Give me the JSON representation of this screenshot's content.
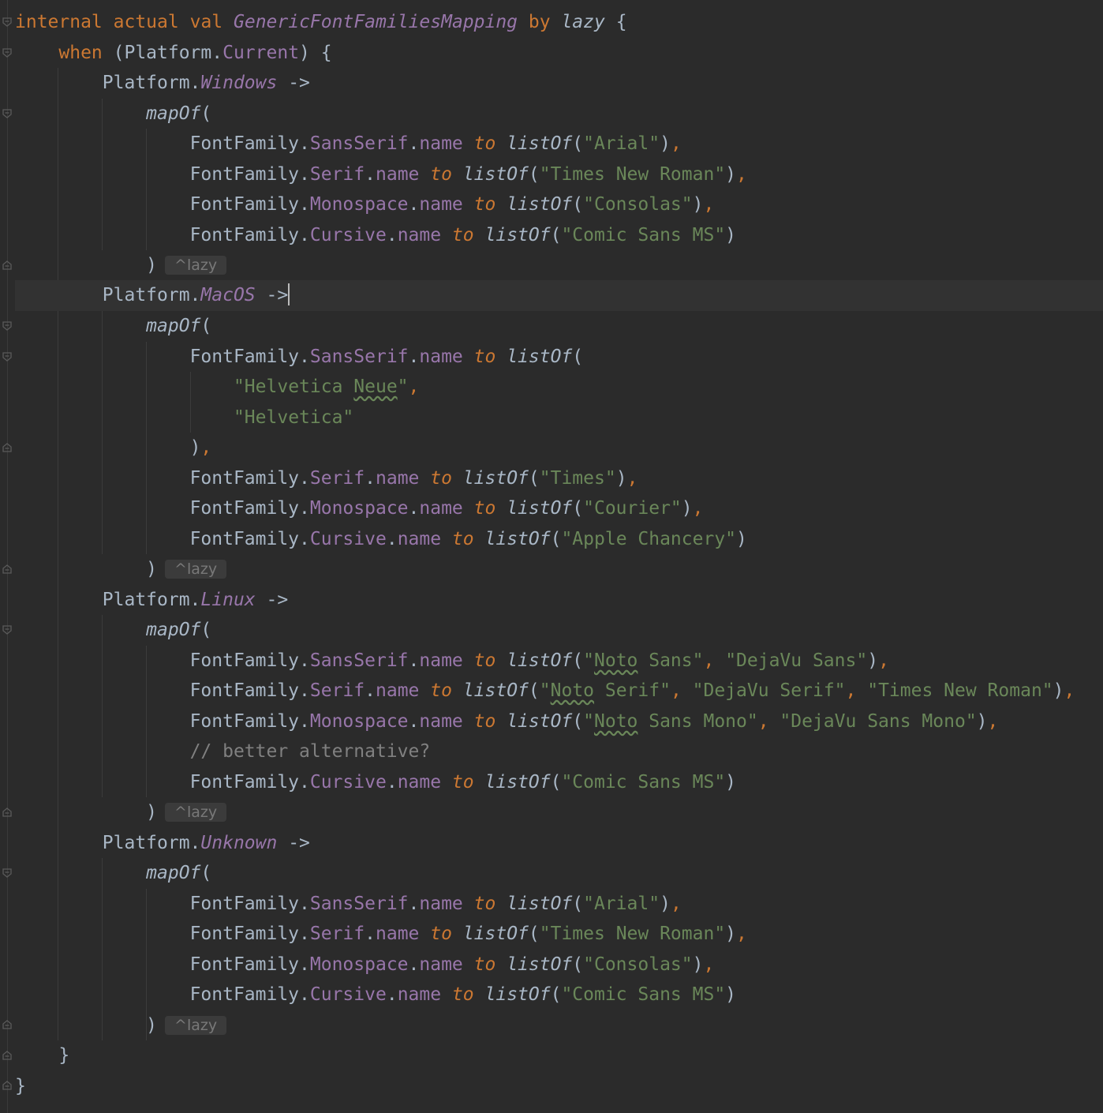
{
  "editor": {
    "language": "Kotlin",
    "theme_colors": {
      "background": "#2b2b2b",
      "current_line": "#323232",
      "keyword": "#cc7832",
      "property": "#9876aa",
      "string": "#6a8759",
      "comment": "#808080",
      "default": "#a9b7c6"
    },
    "icons": {
      "intention_bulb": "lightbulb-icon",
      "fold_marker": "fold-marker-icon"
    },
    "caret_after_line": 10
  },
  "code": {
    "l1": {
      "kw1": "internal",
      "kw2": "actual",
      "kw3": "val",
      "name": "GenericFontFamiliesMapping",
      "kw4": "by",
      "fn": "lazy",
      "open": " {"
    },
    "l2": {
      "kw": "when",
      "rest": " (Platform.",
      "prop": "Current",
      "end": ") {"
    },
    "l3": {
      "pre": "Platform.",
      "prop": "Windows",
      "arrow": " ->"
    },
    "l4": {
      "fn": "mapOf",
      "paren": "("
    },
    "l5": {
      "pre": "FontFamily.",
      "family": "SansSerif",
      "dot": ".",
      "name": "name",
      "to": "to",
      "fn": "listOf",
      "open": "(",
      "s1": "\"Arial\"",
      "close": ")",
      "comma": ","
    },
    "l6": {
      "pre": "FontFamily.",
      "family": "Serif",
      "dot": ".",
      "name": "name",
      "to": "to",
      "fn": "listOf",
      "open": "(",
      "s1": "\"Times New Roman\"",
      "close": ")",
      "comma": ","
    },
    "l7": {
      "pre": "FontFamily.",
      "family": "Monospace",
      "dot": ".",
      "name": "name",
      "to": "to",
      "fn": "listOf",
      "open": "(",
      "s1": "\"Consolas\"",
      "close": ")",
      "comma": ","
    },
    "l8": {
      "pre": "FontFamily.",
      "family": "Cursive",
      "dot": ".",
      "name": "name",
      "to": "to",
      "fn": "listOf",
      "open": "(",
      "s1": "\"Comic Sans MS\"",
      "close": ")"
    },
    "l9": {
      "paren": ")",
      "hint": "^lazy"
    },
    "l10": {
      "pre": "Platform.",
      "prop": "MacOS",
      "arrow": " ->"
    },
    "l11": {
      "fn": "mapOf",
      "paren": "("
    },
    "l12": {
      "pre": "FontFamily.",
      "family": "SansSerif",
      "dot": ".",
      "name": "name",
      "to": "to",
      "fn": "listOf",
      "open": "("
    },
    "l13": {
      "q1": "\"Helvetica ",
      "typo": "Neue",
      "q2": "\"",
      "comma": ","
    },
    "l14": {
      "s1": "\"Helvetica\""
    },
    "l15": {
      "close": ")",
      "comma": ","
    },
    "l16": {
      "pre": "FontFamily.",
      "family": "Serif",
      "dot": ".",
      "name": "name",
      "to": "to",
      "fn": "listOf",
      "open": "(",
      "s1": "\"Times\"",
      "close": ")",
      "comma": ","
    },
    "l17": {
      "pre": "FontFamily.",
      "family": "Monospace",
      "dot": ".",
      "name": "name",
      "to": "to",
      "fn": "listOf",
      "open": "(",
      "s1": "\"Courier\"",
      "close": ")",
      "comma": ","
    },
    "l18": {
      "pre": "FontFamily.",
      "family": "Cursive",
      "dot": ".",
      "name": "name",
      "to": "to",
      "fn": "listOf",
      "open": "(",
      "s1": "\"Apple Chancery\"",
      "close": ")"
    },
    "l19": {
      "paren": ")",
      "hint": "^lazy"
    },
    "l20": {
      "pre": "Platform.",
      "prop": "Linux",
      "arrow": " ->"
    },
    "l21": {
      "fn": "mapOf",
      "paren": "("
    },
    "l22": {
      "pre": "FontFamily.",
      "family": "SansSerif",
      "dot": ".",
      "name": "name",
      "to": "to",
      "fn": "listOf",
      "open": "(",
      "q": "\"",
      "typo": "Noto",
      "s1rest": " Sans\"",
      "sep": ", ",
      "s2": "\"DejaVu Sans\"",
      "close": ")",
      "comma": ","
    },
    "l23": {
      "pre": "FontFamily.",
      "family": "Serif",
      "dot": ".",
      "name": "name",
      "to": "to",
      "fn": "listOf",
      "open": "(",
      "q": "\"",
      "typo": "Noto",
      "s1rest": " Serif\"",
      "sep": ", ",
      "s2": "\"DejaVu Serif\"",
      "sep2": ", ",
      "s3": "\"Times New Roman\"",
      "close": ")",
      "comma": ","
    },
    "l24": {
      "pre": "FontFamily.",
      "family": "Monospace",
      "dot": ".",
      "name": "name",
      "to": "to",
      "fn": "listOf",
      "open": "(",
      "q": "\"",
      "typo": "Noto",
      "s1rest": " Sans Mono\"",
      "sep": ", ",
      "s2": "\"DejaVu Sans Mono\"",
      "close": ")",
      "comma": ","
    },
    "l25": {
      "comment": "// better alternative?"
    },
    "l26": {
      "pre": "FontFamily.",
      "family": "Cursive",
      "dot": ".",
      "name": "name",
      "to": "to",
      "fn": "listOf",
      "open": "(",
      "s1": "\"Comic Sans MS\"",
      "close": ")"
    },
    "l27": {
      "paren": ")",
      "hint": "^lazy"
    },
    "l28": {
      "pre": "Platform.",
      "prop": "Unknown",
      "arrow": " ->"
    },
    "l29": {
      "fn": "mapOf",
      "paren": "("
    },
    "l30": {
      "pre": "FontFamily.",
      "family": "SansSerif",
      "dot": ".",
      "name": "name",
      "to": "to",
      "fn": "listOf",
      "open": "(",
      "s1": "\"Arial\"",
      "close": ")",
      "comma": ","
    },
    "l31": {
      "pre": "FontFamily.",
      "family": "Serif",
      "dot": ".",
      "name": "name",
      "to": "to",
      "fn": "listOf",
      "open": "(",
      "s1": "\"Times New Roman\"",
      "close": ")",
      "comma": ","
    },
    "l32": {
      "pre": "FontFamily.",
      "family": "Monospace",
      "dot": ".",
      "name": "name",
      "to": "to",
      "fn": "listOf",
      "open": "(",
      "s1": "\"Consolas\"",
      "close": ")",
      "comma": ","
    },
    "l33": {
      "pre": "FontFamily.",
      "family": "Cursive",
      "dot": ".",
      "name": "name",
      "to": "to",
      "fn": "listOf",
      "open": "(",
      "s1": "\"Comic Sans MS\"",
      "close": ")"
    },
    "l34": {
      "paren": ")",
      "hint": "^lazy"
    },
    "l35": {
      "brace": "}"
    },
    "l36": {
      "brace": "}"
    }
  }
}
